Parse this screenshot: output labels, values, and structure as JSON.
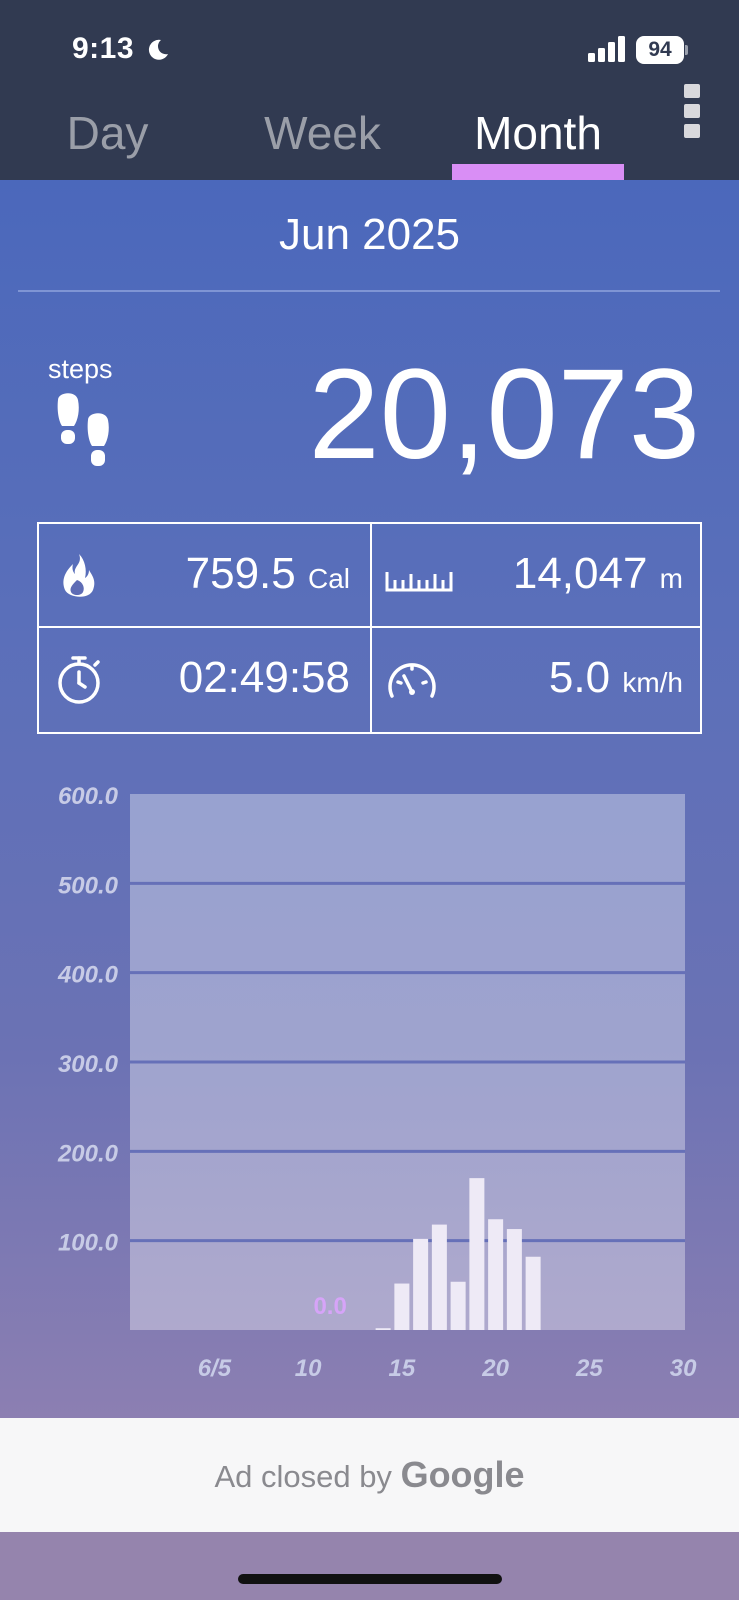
{
  "status_bar": {
    "time": "9:13",
    "battery": "94"
  },
  "tabs": [
    {
      "label": "Day",
      "active": false
    },
    {
      "label": "Week",
      "active": false
    },
    {
      "label": "Month",
      "active": true
    }
  ],
  "period": "Jun 2025",
  "steps": {
    "label": "steps",
    "value": "20,073"
  },
  "stats": {
    "calories": {
      "value": "759.5",
      "unit": "Cal",
      "icon": "flame-icon"
    },
    "distance": {
      "value": "14,047",
      "unit": "m",
      "icon": "ruler-icon"
    },
    "duration": {
      "value": "02:49:58",
      "icon": "stopwatch-icon"
    },
    "speed": {
      "value": "5.0",
      "unit": "km/h",
      "icon": "speedometer-icon"
    }
  },
  "chart_data": {
    "type": "bar",
    "x": [
      14,
      15,
      16,
      17,
      18,
      19,
      20,
      21,
      22
    ],
    "values": [
      2,
      52,
      102,
      118,
      54,
      170,
      124,
      113,
      82
    ],
    "ylim": [
      0,
      600
    ],
    "yticks": [
      "100.0",
      "200.0",
      "300.0",
      "400.0",
      "500.0",
      "600.0"
    ],
    "xtick_labels": [
      "6/5",
      "10",
      "15",
      "20",
      "25",
      "30"
    ],
    "annotation": "0.0",
    "grid": true
  },
  "ad": {
    "text": "Ad closed by",
    "brand": "Google"
  },
  "colors": {
    "header_bg": "#313a51",
    "tab_indicator": "#d98ef5",
    "bar": "#eeeaf6",
    "annotation": "#d6a4f8"
  }
}
